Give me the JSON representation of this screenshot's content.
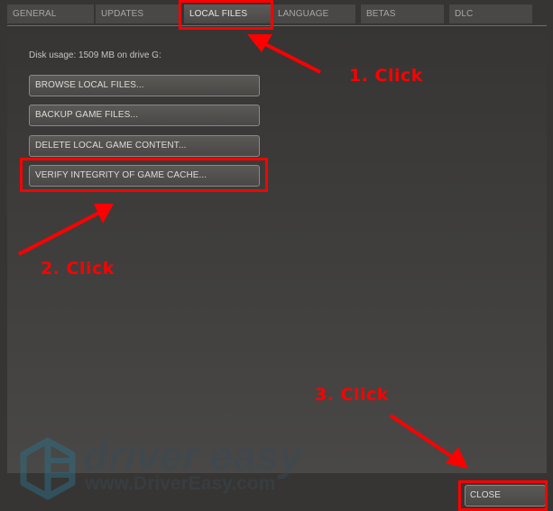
{
  "tabs": [
    {
      "label": "GENERAL",
      "active": false
    },
    {
      "label": "UPDATES",
      "active": false
    },
    {
      "label": "LOCAL FILES",
      "active": true
    },
    {
      "label": "LANGUAGE",
      "active": false
    },
    {
      "label": "BETAS",
      "active": false
    },
    {
      "label": "DLC",
      "active": false
    }
  ],
  "local_files": {
    "disk_usage": "Disk usage: 1509 MB on drive G:",
    "buttons": [
      {
        "label": "BROWSE LOCAL FILES..."
      },
      {
        "label": "BACKUP GAME FILES..."
      },
      {
        "label": "DELETE LOCAL GAME CONTENT..."
      },
      {
        "label": "VERIFY INTEGRITY OF GAME CACHE..."
      }
    ]
  },
  "footer": {
    "close_label": "CLOSE"
  },
  "annotations": {
    "step1": "1. Click",
    "step2": "2. Click",
    "step3": "3. Click",
    "color": "#ff0000"
  },
  "watermark": {
    "brand": "driver easy",
    "url": "www.DriverEasy.com"
  }
}
